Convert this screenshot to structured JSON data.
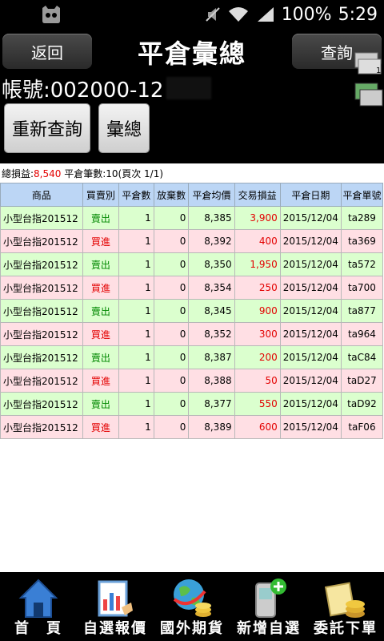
{
  "status": {
    "battery_text": "100%",
    "time": "5:29"
  },
  "header": {
    "back_label": "返回",
    "title": "平倉彙總",
    "query_label": "查詢"
  },
  "account": {
    "label": "帳號:002000-12"
  },
  "actions": {
    "requery_label": "重新查詢",
    "summary_label": "彙總"
  },
  "summary": {
    "total_pl_label": "總損益:",
    "total_pl_value": "8,540",
    "count_text": " 平倉筆數:10(頁次 1/1)"
  },
  "table": {
    "headers": [
      "商品",
      "買賣別",
      "平倉數",
      "放棄數",
      "平倉均價",
      "交易損益",
      "平倉日期",
      "平倉單號"
    ],
    "rows": [
      {
        "product": "小型台指201512",
        "side": "賣出",
        "qty": "1",
        "abandon": "0",
        "price": "8,385",
        "pl": "3,900",
        "date": "2015/12/04",
        "no": "ta289"
      },
      {
        "product": "小型台指201512",
        "side": "買進",
        "qty": "1",
        "abandon": "0",
        "price": "8,392",
        "pl": "400",
        "date": "2015/12/04",
        "no": "ta369"
      },
      {
        "product": "小型台指201512",
        "side": "賣出",
        "qty": "1",
        "abandon": "0",
        "price": "8,350",
        "pl": "1,950",
        "date": "2015/12/04",
        "no": "ta572"
      },
      {
        "product": "小型台指201512",
        "side": "買進",
        "qty": "1",
        "abandon": "0",
        "price": "8,354",
        "pl": "250",
        "date": "2015/12/04",
        "no": "ta700"
      },
      {
        "product": "小型台指201512",
        "side": "賣出",
        "qty": "1",
        "abandon": "0",
        "price": "8,345",
        "pl": "900",
        "date": "2015/12/04",
        "no": "ta877"
      },
      {
        "product": "小型台指201512",
        "side": "買進",
        "qty": "1",
        "abandon": "0",
        "price": "8,352",
        "pl": "300",
        "date": "2015/12/04",
        "no": "ta964"
      },
      {
        "product": "小型台指201512",
        "side": "賣出",
        "qty": "1",
        "abandon": "0",
        "price": "8,387",
        "pl": "200",
        "date": "2015/12/04",
        "no": "taC84"
      },
      {
        "product": "小型台指201512",
        "side": "買進",
        "qty": "1",
        "abandon": "0",
        "price": "8,388",
        "pl": "50",
        "date": "2015/12/04",
        "no": "taD27"
      },
      {
        "product": "小型台指201512",
        "side": "賣出",
        "qty": "1",
        "abandon": "0",
        "price": "8,377",
        "pl": "550",
        "date": "2015/12/04",
        "no": "taD92"
      },
      {
        "product": "小型台指201512",
        "side": "買進",
        "qty": "1",
        "abandon": "0",
        "price": "8,389",
        "pl": "600",
        "date": "2015/12/04",
        "no": "taF06"
      }
    ]
  },
  "bottom_nav": [
    {
      "label": "首　頁",
      "icon": "home-icon"
    },
    {
      "label": "自選報價",
      "icon": "quote-chart-icon"
    },
    {
      "label": "國外期貨",
      "icon": "globe-coins-icon"
    },
    {
      "label": "新增自選",
      "icon": "phone-add-icon"
    },
    {
      "label": "委託下單",
      "icon": "coins-order-icon"
    }
  ],
  "colors": {
    "header_row": "#bcd6f5",
    "sell_row": "#dbffce",
    "buy_row": "#ffdfe4",
    "profit_red": "#e30000",
    "sell_green": "#008800"
  }
}
